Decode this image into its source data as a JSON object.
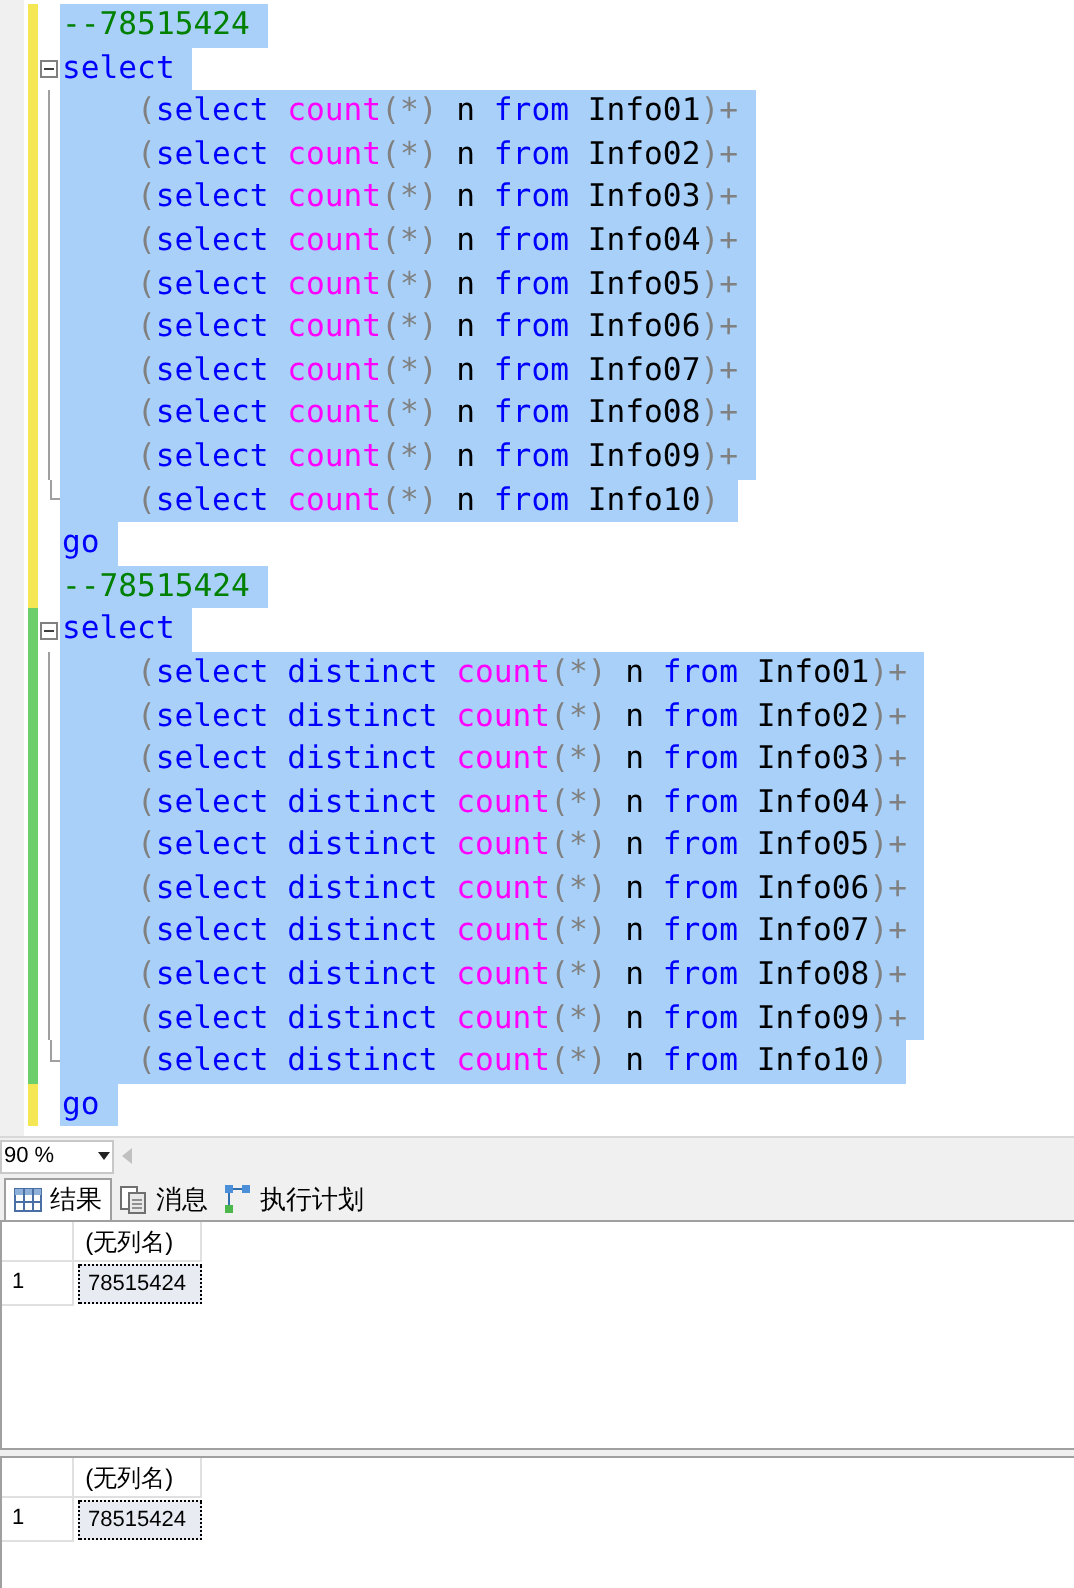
{
  "editor": {
    "lines": [
      {
        "saved": false,
        "kind": "plain",
        "tokens": [
          {
            "kind": "comment",
            "text": "--78515424"
          }
        ]
      },
      {
        "saved": false,
        "kind": "block_start",
        "tokens": [
          {
            "kind": "keyword",
            "text": "select"
          }
        ]
      },
      {
        "saved": false,
        "kind": "block_line",
        "tokens": [
          {
            "kind": "operator",
            "text": "("
          },
          {
            "kind": "keyword",
            "text": "select"
          },
          {
            "kind": "function",
            "text": "count"
          },
          {
            "kind": "operator",
            "text": "(*)"
          },
          {
            "kind": "text",
            "text": "n"
          },
          {
            "kind": "keyword",
            "text": "from"
          },
          {
            "kind": "text",
            "text": "Info01"
          },
          {
            "kind": "operator",
            "text": ")+"
          }
        ]
      },
      {
        "saved": false,
        "kind": "block_line",
        "tokens": [
          {
            "kind": "operator",
            "text": "("
          },
          {
            "kind": "keyword",
            "text": "select"
          },
          {
            "kind": "function",
            "text": "count"
          },
          {
            "kind": "operator",
            "text": "(*)"
          },
          {
            "kind": "text",
            "text": "n"
          },
          {
            "kind": "keyword",
            "text": "from"
          },
          {
            "kind": "text",
            "text": "Info02"
          },
          {
            "kind": "operator",
            "text": ")+"
          }
        ]
      },
      {
        "saved": false,
        "kind": "block_line",
        "tokens": [
          {
            "kind": "operator",
            "text": "("
          },
          {
            "kind": "keyword",
            "text": "select"
          },
          {
            "kind": "function",
            "text": "count"
          },
          {
            "kind": "operator",
            "text": "(*)"
          },
          {
            "kind": "text",
            "text": "n"
          },
          {
            "kind": "keyword",
            "text": "from"
          },
          {
            "kind": "text",
            "text": "Info03"
          },
          {
            "kind": "operator",
            "text": ")+"
          }
        ]
      },
      {
        "saved": false,
        "kind": "block_line",
        "tokens": [
          {
            "kind": "operator",
            "text": "("
          },
          {
            "kind": "keyword",
            "text": "select"
          },
          {
            "kind": "function",
            "text": "count"
          },
          {
            "kind": "operator",
            "text": "(*)"
          },
          {
            "kind": "text",
            "text": "n"
          },
          {
            "kind": "keyword",
            "text": "from"
          },
          {
            "kind": "text",
            "text": "Info04"
          },
          {
            "kind": "operator",
            "text": ")+"
          }
        ]
      },
      {
        "saved": false,
        "kind": "block_line",
        "tokens": [
          {
            "kind": "operator",
            "text": "("
          },
          {
            "kind": "keyword",
            "text": "select"
          },
          {
            "kind": "function",
            "text": "count"
          },
          {
            "kind": "operator",
            "text": "(*)"
          },
          {
            "kind": "text",
            "text": "n"
          },
          {
            "kind": "keyword",
            "text": "from"
          },
          {
            "kind": "text",
            "text": "Info05"
          },
          {
            "kind": "operator",
            "text": ")+"
          }
        ]
      },
      {
        "saved": false,
        "kind": "block_line",
        "tokens": [
          {
            "kind": "operator",
            "text": "("
          },
          {
            "kind": "keyword",
            "text": "select"
          },
          {
            "kind": "function",
            "text": "count"
          },
          {
            "kind": "operator",
            "text": "(*)"
          },
          {
            "kind": "text",
            "text": "n"
          },
          {
            "kind": "keyword",
            "text": "from"
          },
          {
            "kind": "text",
            "text": "Info06"
          },
          {
            "kind": "operator",
            "text": ")+"
          }
        ]
      },
      {
        "saved": false,
        "kind": "block_line",
        "tokens": [
          {
            "kind": "operator",
            "text": "("
          },
          {
            "kind": "keyword",
            "text": "select"
          },
          {
            "kind": "function",
            "text": "count"
          },
          {
            "kind": "operator",
            "text": "(*)"
          },
          {
            "kind": "text",
            "text": "n"
          },
          {
            "kind": "keyword",
            "text": "from"
          },
          {
            "kind": "text",
            "text": "Info07"
          },
          {
            "kind": "operator",
            "text": ")+"
          }
        ]
      },
      {
        "saved": false,
        "kind": "block_line",
        "tokens": [
          {
            "kind": "operator",
            "text": "("
          },
          {
            "kind": "keyword",
            "text": "select"
          },
          {
            "kind": "function",
            "text": "count"
          },
          {
            "kind": "operator",
            "text": "(*)"
          },
          {
            "kind": "text",
            "text": "n"
          },
          {
            "kind": "keyword",
            "text": "from"
          },
          {
            "kind": "text",
            "text": "Info08"
          },
          {
            "kind": "operator",
            "text": ")+"
          }
        ]
      },
      {
        "saved": false,
        "kind": "block_line",
        "tokens": [
          {
            "kind": "operator",
            "text": "("
          },
          {
            "kind": "keyword",
            "text": "select"
          },
          {
            "kind": "function",
            "text": "count"
          },
          {
            "kind": "operator",
            "text": "(*)"
          },
          {
            "kind": "text",
            "text": "n"
          },
          {
            "kind": "keyword",
            "text": "from"
          },
          {
            "kind": "text",
            "text": "Info09"
          },
          {
            "kind": "operator",
            "text": ")+"
          }
        ]
      },
      {
        "saved": false,
        "kind": "block_end",
        "tokens": [
          {
            "kind": "operator",
            "text": "("
          },
          {
            "kind": "keyword",
            "text": "select"
          },
          {
            "kind": "function",
            "text": "count"
          },
          {
            "kind": "operator",
            "text": "(*)"
          },
          {
            "kind": "text",
            "text": "n"
          },
          {
            "kind": "keyword",
            "text": "from"
          },
          {
            "kind": "text",
            "text": "Info10"
          },
          {
            "kind": "operator",
            "text": ")"
          }
        ]
      },
      {
        "saved": false,
        "kind": "plain",
        "tokens": [
          {
            "kind": "keyword",
            "text": "go"
          }
        ]
      },
      {
        "saved": false,
        "kind": "plain",
        "tokens": [
          {
            "kind": "comment",
            "text": "--78515424"
          }
        ]
      },
      {
        "saved": true,
        "kind": "block_start",
        "tokens": [
          {
            "kind": "keyword",
            "text": "select"
          }
        ]
      },
      {
        "saved": true,
        "kind": "block_line",
        "tokens": [
          {
            "kind": "operator",
            "text": "("
          },
          {
            "kind": "keyword",
            "text": "select distinct"
          },
          {
            "kind": "function",
            "text": "count"
          },
          {
            "kind": "operator",
            "text": "(*)"
          },
          {
            "kind": "text",
            "text": "n"
          },
          {
            "kind": "keyword",
            "text": "from"
          },
          {
            "kind": "text",
            "text": "Info01"
          },
          {
            "kind": "operator",
            "text": ")+"
          }
        ]
      },
      {
        "saved": true,
        "kind": "block_line",
        "tokens": [
          {
            "kind": "operator",
            "text": "("
          },
          {
            "kind": "keyword",
            "text": "select distinct"
          },
          {
            "kind": "function",
            "text": "count"
          },
          {
            "kind": "operator",
            "text": "(*)"
          },
          {
            "kind": "text",
            "text": "n"
          },
          {
            "kind": "keyword",
            "text": "from"
          },
          {
            "kind": "text",
            "text": "Info02"
          },
          {
            "kind": "operator",
            "text": ")+"
          }
        ]
      },
      {
        "saved": true,
        "kind": "block_line",
        "tokens": [
          {
            "kind": "operator",
            "text": "("
          },
          {
            "kind": "keyword",
            "text": "select distinct"
          },
          {
            "kind": "function",
            "text": "count"
          },
          {
            "kind": "operator",
            "text": "(*)"
          },
          {
            "kind": "text",
            "text": "n"
          },
          {
            "kind": "keyword",
            "text": "from"
          },
          {
            "kind": "text",
            "text": "Info03"
          },
          {
            "kind": "operator",
            "text": ")+"
          }
        ]
      },
      {
        "saved": true,
        "kind": "block_line",
        "tokens": [
          {
            "kind": "operator",
            "text": "("
          },
          {
            "kind": "keyword",
            "text": "select distinct"
          },
          {
            "kind": "function",
            "text": "count"
          },
          {
            "kind": "operator",
            "text": "(*)"
          },
          {
            "kind": "text",
            "text": "n"
          },
          {
            "kind": "keyword",
            "text": "from"
          },
          {
            "kind": "text",
            "text": "Info04"
          },
          {
            "kind": "operator",
            "text": ")+"
          }
        ]
      },
      {
        "saved": true,
        "kind": "block_line",
        "tokens": [
          {
            "kind": "operator",
            "text": "("
          },
          {
            "kind": "keyword",
            "text": "select distinct"
          },
          {
            "kind": "function",
            "text": "count"
          },
          {
            "kind": "operator",
            "text": "(*)"
          },
          {
            "kind": "text",
            "text": "n"
          },
          {
            "kind": "keyword",
            "text": "from"
          },
          {
            "kind": "text",
            "text": "Info05"
          },
          {
            "kind": "operator",
            "text": ")+"
          }
        ]
      },
      {
        "saved": true,
        "kind": "block_line",
        "tokens": [
          {
            "kind": "operator",
            "text": "("
          },
          {
            "kind": "keyword",
            "text": "select distinct"
          },
          {
            "kind": "function",
            "text": "count"
          },
          {
            "kind": "operator",
            "text": "(*)"
          },
          {
            "kind": "text",
            "text": "n"
          },
          {
            "kind": "keyword",
            "text": "from"
          },
          {
            "kind": "text",
            "text": "Info06"
          },
          {
            "kind": "operator",
            "text": ")+"
          }
        ]
      },
      {
        "saved": true,
        "kind": "block_line",
        "tokens": [
          {
            "kind": "operator",
            "text": "("
          },
          {
            "kind": "keyword",
            "text": "select distinct"
          },
          {
            "kind": "function",
            "text": "count"
          },
          {
            "kind": "operator",
            "text": "(*)"
          },
          {
            "kind": "text",
            "text": "n"
          },
          {
            "kind": "keyword",
            "text": "from"
          },
          {
            "kind": "text",
            "text": "Info07"
          },
          {
            "kind": "operator",
            "text": ")+"
          }
        ]
      },
      {
        "saved": true,
        "kind": "block_line",
        "tokens": [
          {
            "kind": "operator",
            "text": "("
          },
          {
            "kind": "keyword",
            "text": "select distinct"
          },
          {
            "kind": "function",
            "text": "count"
          },
          {
            "kind": "operator",
            "text": "(*)"
          },
          {
            "kind": "text",
            "text": "n"
          },
          {
            "kind": "keyword",
            "text": "from"
          },
          {
            "kind": "text",
            "text": "Info08"
          },
          {
            "kind": "operator",
            "text": ")+"
          }
        ]
      },
      {
        "saved": true,
        "kind": "block_line",
        "tokens": [
          {
            "kind": "operator",
            "text": "("
          },
          {
            "kind": "keyword",
            "text": "select distinct"
          },
          {
            "kind": "function",
            "text": "count"
          },
          {
            "kind": "operator",
            "text": "(*)"
          },
          {
            "kind": "text",
            "text": "n"
          },
          {
            "kind": "keyword",
            "text": "from"
          },
          {
            "kind": "text",
            "text": "Info09"
          },
          {
            "kind": "operator",
            "text": ")+"
          }
        ]
      },
      {
        "saved": true,
        "kind": "block_end",
        "tokens": [
          {
            "kind": "operator",
            "text": "("
          },
          {
            "kind": "keyword",
            "text": "select distinct"
          },
          {
            "kind": "function",
            "text": "count"
          },
          {
            "kind": "operator",
            "text": "(*)"
          },
          {
            "kind": "text",
            "text": "n"
          },
          {
            "kind": "keyword",
            "text": "from"
          },
          {
            "kind": "text",
            "text": "Info10"
          },
          {
            "kind": "operator",
            "text": ")"
          }
        ]
      },
      {
        "saved": false,
        "kind": "plain",
        "tokens": [
          {
            "kind": "keyword",
            "text": "go"
          }
        ]
      }
    ]
  },
  "zoom": {
    "value": "90 %"
  },
  "tabs": [
    {
      "label": "结果",
      "kind": "grid",
      "selected": true
    },
    {
      "label": "消息",
      "kind": "messages",
      "selected": false
    },
    {
      "label": "执行计划",
      "kind": "plan",
      "selected": false
    }
  ],
  "results": [
    {
      "columns": [
        "(无列名)"
      ],
      "rows": [
        {
          "number": "1",
          "cells": [
            "78515424"
          ]
        }
      ]
    },
    {
      "columns": [
        "(无列名)"
      ],
      "rows": [
        {
          "number": "1",
          "cells": [
            "78515424"
          ]
        }
      ]
    }
  ]
}
